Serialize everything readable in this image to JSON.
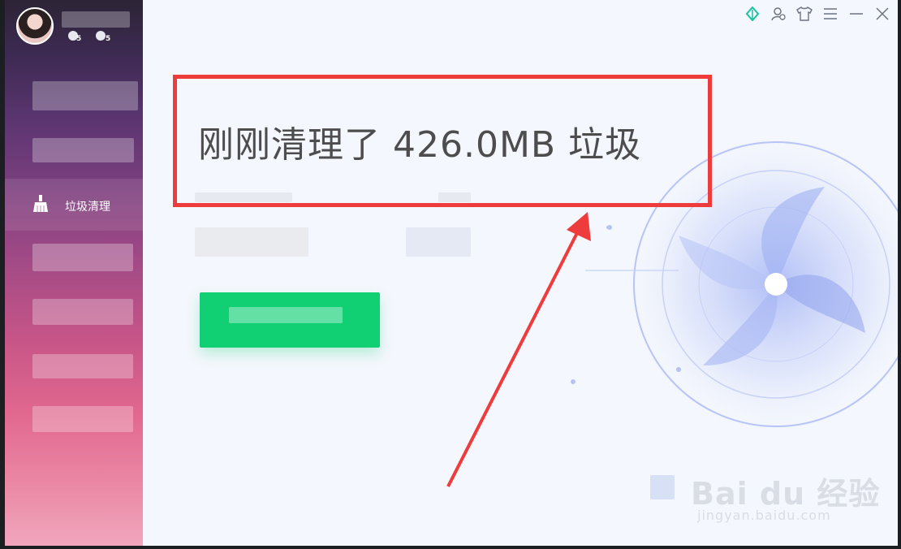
{
  "sidebar": {
    "badge_one": "5",
    "badge_two": "5",
    "active_item_label": "垃圾清理"
  },
  "main": {
    "title": "刚刚清理了 426.0MB 垃圾"
  },
  "watermark": {
    "brand": "Bai du 经验",
    "sub": "jingyan.baidu.com"
  },
  "colors": {
    "accent_green": "#11cf73",
    "highlight_red": "#ee3b3b",
    "text_dark": "#4d4d4d"
  }
}
